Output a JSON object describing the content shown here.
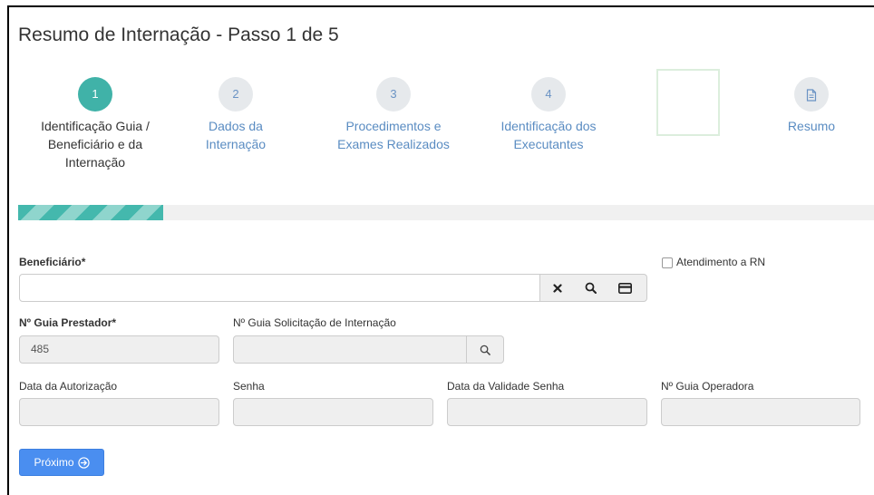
{
  "page_title": "Resumo de Internação - Passo 1 de 5",
  "steps": [
    {
      "number": "1",
      "label": "Identificação Guia / Beneficiário e da Internação",
      "active": true
    },
    {
      "number": "2",
      "label": "Dados da Internação",
      "active": false
    },
    {
      "number": "3",
      "label": "Procedimentos e Exames Realizados",
      "active": false
    },
    {
      "number": "4",
      "label": "Identificação dos Executantes",
      "active": false
    },
    {
      "number": "",
      "icon": "document-icon",
      "label": "Resumo",
      "active": false
    }
  ],
  "progress": {
    "fraction": 0.17
  },
  "form": {
    "beneficiario_label": "Beneficiário*",
    "beneficiario_value": "",
    "atendimento_rn_label": "Atendimento a RN",
    "atendimento_rn_checked": false,
    "guia_prestador_label": "Nº Guia Prestador*",
    "guia_prestador_value": "485",
    "guia_solicitacao_label": "Nº Guia Solicitação de Internação",
    "guia_solicitacao_value": "",
    "data_autorizacao_label": "Data da Autorização",
    "data_autorizacao_value": "",
    "senha_label": "Senha",
    "senha_value": "",
    "data_validade_label": "Data da Validade Senha",
    "data_validade_value": "",
    "guia_operadora_label": "Nº Guia Operadora",
    "guia_operadora_value": ""
  },
  "icons": {
    "clear": "close-icon",
    "search": "search-icon",
    "card": "card-icon"
  },
  "buttons": {
    "next_label": "Próximo"
  },
  "colors": {
    "active_step": "#40b2a8",
    "inactive_step_text": "#5a8cc2",
    "primary_button": "#4a8ef0",
    "progress_fill": "#44b8ad"
  }
}
